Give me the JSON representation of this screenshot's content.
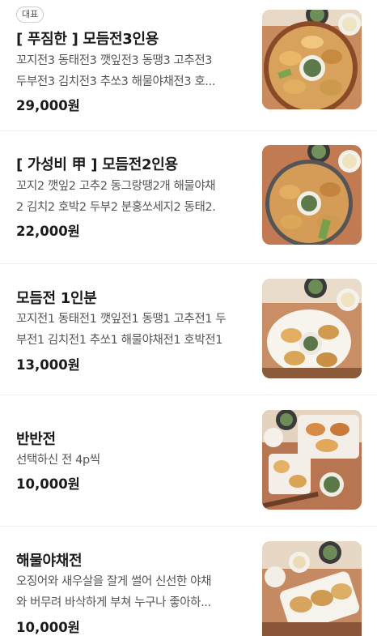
{
  "menu": {
    "items": [
      {
        "badge": "대표",
        "title": "[ 푸짐한 ] 모듬전3인용",
        "desc_line1": "꼬지전3 동태전3 깻잎전3 동땡3 고추전3",
        "desc_line2": "두부전3 김치전3 추쏘3 해물야채전3 호...",
        "price": "29,000원"
      },
      {
        "title": "[ 가성비 甲 ] 모듬전2인용",
        "desc_line1": "꼬지2 깻잎2 고추2 동그랑땡2개 해물야채",
        "desc_line2": "2 김치2 호박2 두부2 분홍쏘세지2 동태2.",
        "price": "22,000원"
      },
      {
        "title": "모듬전 1인분",
        "desc_line1": "꼬지전1 동태전1 깻잎전1 동땡1 고추전1 두",
        "desc_line2": "부전1 김치전1 추쏘1 해물야채전1 호박전1",
        "price": "13,000원"
      },
      {
        "title": "반반전",
        "desc_line1": "선택하신 전 4p씩",
        "desc_line2": "",
        "price": "10,000원"
      },
      {
        "title": "해물야채전",
        "desc_line1": "오징어와 새우살을 잘게 썰어 신선한 야채",
        "desc_line2": "와 버무려 바삭하게 부쳐 누구나 좋아하...",
        "price": "10,000원"
      }
    ]
  }
}
